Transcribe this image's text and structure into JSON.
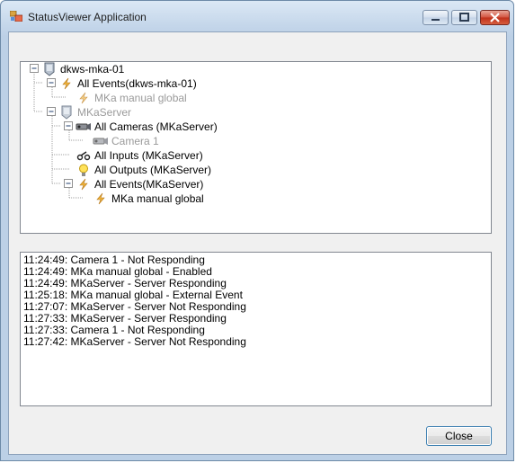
{
  "window": {
    "title": "StatusViewer Application"
  },
  "tree": {
    "nodes": [
      {
        "label": "dkws-mka-01",
        "icon": "server-icon",
        "dim": false
      },
      {
        "label": "All Events(dkws-mka-01)",
        "icon": "lightning-icon",
        "dim": false
      },
      {
        "label": "MKa manual global",
        "icon": "lightning-icon",
        "dim": true
      },
      {
        "label": "MKaServer",
        "icon": "server-icon",
        "dim": true
      },
      {
        "label": "All Cameras (MKaServer)",
        "icon": "camera-icon",
        "dim": false
      },
      {
        "label": "Camera 1",
        "icon": "camera-icon",
        "dim": true
      },
      {
        "label": "All Inputs (MKaServer)",
        "icon": "input-icon",
        "dim": false
      },
      {
        "label": "All Outputs (MKaServer)",
        "icon": "lightbulb-icon",
        "dim": false
      },
      {
        "label": "All Events(MKaServer)",
        "icon": "lightning-icon",
        "dim": false
      },
      {
        "label": "MKa manual global",
        "icon": "lightning-icon",
        "dim": false
      }
    ]
  },
  "log": {
    "lines": [
      "11:24:49: Camera 1 - Not Responding",
      "11:24:49: MKa manual global - Enabled",
      "11:24:49: MKaServer - Server Responding",
      "11:25:18: MKa manual global - External Event",
      "11:27:07: MKaServer - Server Not Responding",
      "11:27:33: MKaServer - Server Responding",
      "11:27:33: Camera 1 - Not Responding",
      "11:27:42: MKaServer - Server Not Responding"
    ]
  },
  "buttons": {
    "close": "Close"
  },
  "colors": {
    "title_bar": "#c4d6ea",
    "client_bg": "#f0f0f0",
    "close_button_accent": "#c0301a",
    "dim_text": "#9a9a9a"
  }
}
